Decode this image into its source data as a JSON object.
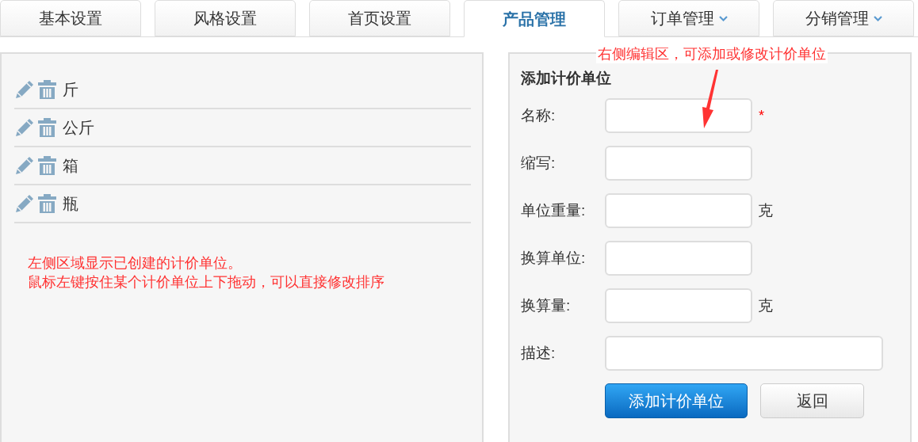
{
  "tabs": [
    {
      "label": "基本设置",
      "selected": false,
      "dropdown": false
    },
    {
      "label": "风格设置",
      "selected": false,
      "dropdown": false
    },
    {
      "label": "首页设置",
      "selected": false,
      "dropdown": false
    },
    {
      "label": "产品管理",
      "selected": true,
      "dropdown": false
    },
    {
      "label": "订单管理",
      "selected": false,
      "dropdown": true
    },
    {
      "label": "分销管理",
      "selected": false,
      "dropdown": true
    }
  ],
  "unit_list": [
    {
      "name": "斤"
    },
    {
      "name": "公斤"
    },
    {
      "name": "箱"
    },
    {
      "name": "瓶"
    }
  ],
  "left_note": [
    "左侧区域显示已创建的计价单位。",
    "鼠标左键按住某个计价单位上下拖动，可以直接修改排序"
  ],
  "right_note": "右侧编辑区，可添加或修改计价单位",
  "form": {
    "title": "添加计价单位",
    "fields": [
      {
        "label": "名称:",
        "kind": "short",
        "required_mark": "*"
      },
      {
        "label": "缩写:",
        "kind": "short"
      },
      {
        "label": "单位重量:",
        "kind": "short",
        "suffix": "克"
      },
      {
        "label": "换算单位:",
        "kind": "short"
      },
      {
        "label": "换算量:",
        "kind": "short",
        "suffix": "克"
      },
      {
        "label": "描述:",
        "kind": "long"
      }
    ],
    "buttons": [
      {
        "label": "添加计价单位",
        "kind": "primary"
      },
      {
        "label": "返回",
        "kind": "default"
      }
    ]
  }
}
